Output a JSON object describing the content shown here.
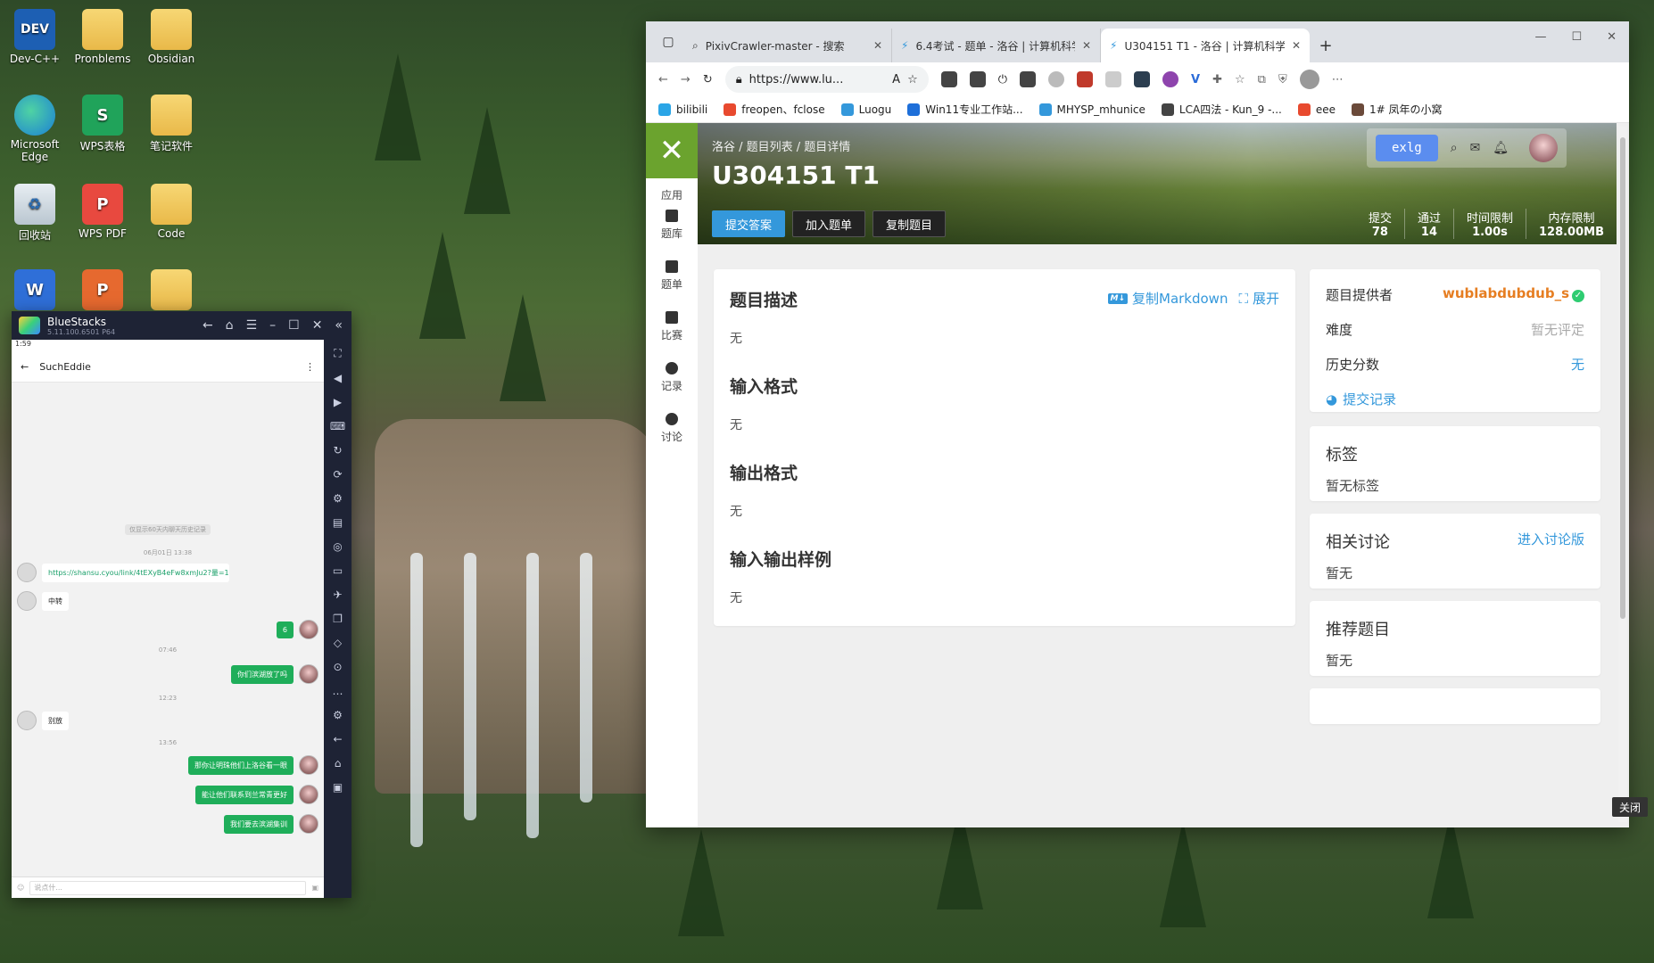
{
  "desktop": {
    "icons": [
      {
        "label": "Dev-C++",
        "icon": "dev-cpp-icon"
      },
      {
        "label": "Pronblems",
        "icon": "folder-icon"
      },
      {
        "label": "Obsidian",
        "icon": "folder-icon"
      },
      {
        "label": "Microsoft Edge",
        "icon": "edge-icon"
      },
      {
        "label": "WPS表格",
        "icon": "wps-sheet-icon"
      },
      {
        "label": "笔记软件",
        "icon": "folder-icon"
      },
      {
        "label": "回收站",
        "icon": "recycle-bin-icon"
      },
      {
        "label": "WPS PDF",
        "icon": "wps-pdf-icon"
      },
      {
        "label": "Code",
        "icon": "folder-icon"
      }
    ],
    "icon_glyphs": {
      "dev": "DEV",
      "wps_sheet": "S",
      "wps_pdf": "P",
      "wps_word": "W",
      "wps_ppt": "P",
      "recycle": "♻"
    }
  },
  "bluestacks": {
    "title": "BlueStacks",
    "version": "5.11.100.6501 P64",
    "status_time": "1:59",
    "chat_name": "SuchEddie",
    "system_notice": "仅显示60天内聊天历史记录",
    "timestamps": [
      "06月01日 13:38",
      "07:46",
      "12:23",
      "13:56"
    ],
    "messages": [
      {
        "dir": "in",
        "text": "https://shansu.cyou/link/4tEXyB4eFw8xmJu2?量=1",
        "link": true
      },
      {
        "dir": "in",
        "text": "中转"
      },
      {
        "dir": "out",
        "text": "6"
      },
      {
        "dir": "out",
        "text": "你们滨湖放了吗"
      },
      {
        "dir": "in",
        "text": "别放"
      },
      {
        "dir": "out",
        "text": "那你让明珠他们上洛谷看一眼"
      },
      {
        "dir": "out",
        "text": "能让他们联系到兰常青更好"
      },
      {
        "dir": "out",
        "text": "我们要去滨湖集训"
      }
    ],
    "input_placeholder": "说点什..."
  },
  "browser": {
    "tabs": [
      {
        "title": "PixivCrawler-master - 搜索",
        "active": false
      },
      {
        "title": "6.4考试 - 题单 - 洛谷 | 计算机科学",
        "active": false
      },
      {
        "title": "U304151 T1 - 洛谷 | 计算机科学",
        "active": true
      }
    ],
    "url": "https://www.lu...",
    "read_aloud": "A",
    "bookmarks": [
      "bilibili",
      "freopen、fclose",
      "Luogu",
      "Win11专业工作站...",
      "MHYSP_mhunice",
      "LCA四法 - Kun_9 -...",
      "eee",
      "1# 凤年の小窝"
    ]
  },
  "luogu": {
    "logo": "✕",
    "apps_label": "应用",
    "nav": [
      "题库",
      "题单",
      "比赛",
      "记录",
      "讨论"
    ],
    "breadcrumb": "洛谷 / 题目列表 / 题目详情",
    "title": "U304151 T1",
    "buttons": {
      "submit": "提交答案",
      "add": "加入题单",
      "copy": "复制题目"
    },
    "stats": [
      {
        "k": "提交",
        "v": "78"
      },
      {
        "k": "通过",
        "v": "14"
      },
      {
        "k": "时间限制",
        "v": "1.00s"
      },
      {
        "k": "内存限制",
        "v": "128.00MB"
      }
    ],
    "username": "exlg",
    "sections": [
      {
        "title": "题目描述",
        "value": "无"
      },
      {
        "title": "输入格式",
        "value": "无"
      },
      {
        "title": "输出格式",
        "value": "无"
      },
      {
        "title": "输入输出样例",
        "value": "无"
      }
    ],
    "copy_markdown": "复制Markdown",
    "md_badge": "M↓",
    "expand": "展开",
    "info": {
      "provider_label": "题目提供者",
      "provider": "wublabdubdub_s",
      "difficulty_label": "难度",
      "difficulty": "暂无评定",
      "history_label": "历史分数",
      "history": "无",
      "submissions": "提交记录"
    },
    "tags": {
      "title": "标签",
      "value": "暂无标签"
    },
    "discussion": {
      "title": "相关讨论",
      "link": "进入讨论版",
      "value": "暂无"
    },
    "recommend": {
      "title": "推荐题目",
      "value": "暂无"
    },
    "close_label": "关闭"
  },
  "colors": {
    "accent": "#3498db",
    "luogu_green": "#6ba32e",
    "provider": "#e67e22"
  }
}
